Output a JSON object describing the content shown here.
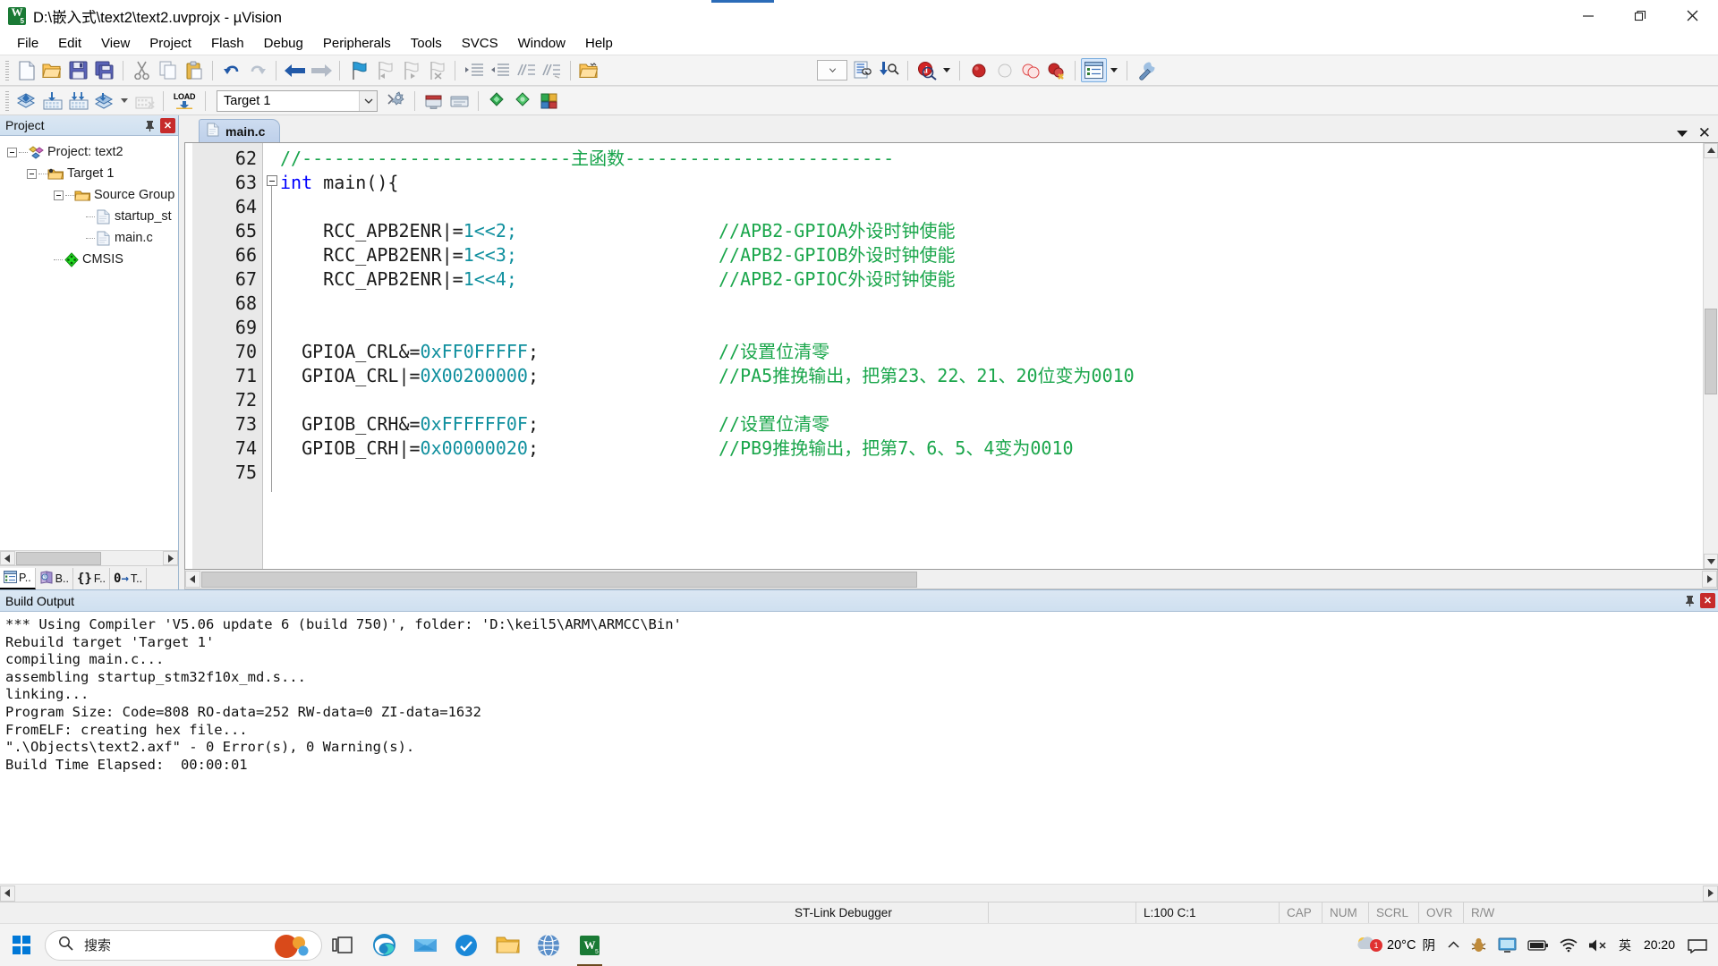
{
  "window": {
    "title": "D:\\嵌入式\\text2\\text2.uvprojx - µVision",
    "app_icon": "keil-uvision-icon",
    "minimize": "—",
    "maximize": "❐",
    "close": "✕"
  },
  "menubar": {
    "items": [
      {
        "label": "File"
      },
      {
        "label": "Edit"
      },
      {
        "label": "View"
      },
      {
        "label": "Project"
      },
      {
        "label": "Flash"
      },
      {
        "label": "Debug"
      },
      {
        "label": "Peripherals"
      },
      {
        "label": "Tools"
      },
      {
        "label": "SVCS"
      },
      {
        "label": "Window"
      },
      {
        "label": "Help"
      }
    ]
  },
  "toolbar_main": {
    "icons": [
      "new-file-icon",
      "open-file-icon",
      "save-icon",
      "save-all-icon",
      "cut-icon",
      "copy-icon",
      "paste-icon",
      "undo-icon",
      "redo-icon",
      "navigate-back-icon",
      "navigate-forward-icon",
      "insert-bookmark-icon",
      "prev-bookmark-icon",
      "next-bookmark-icon",
      "clear-bookmarks-icon",
      "indent-icon",
      "outdent-icon",
      "comment-icon",
      "uncomment-icon",
      "open-folder-browse-icon",
      "dropdown-combo",
      "find-in-files-icon",
      "incremental-find-icon",
      "debug-session-icon",
      "debug-dropdown-caret",
      "insert-breakpoint-icon",
      "disable-breakpoint-icon",
      "kill-all-breakpoints-icon",
      "disable-all-breakpoints-icon",
      "project-window-icon",
      "project-window-caret",
      "configure-target-icon"
    ]
  },
  "toolbar_build": {
    "icons": [
      "translate-icon",
      "build-icon",
      "rebuild-icon",
      "batch-build-icon",
      "batch-build-caret",
      "stop-build-icon",
      "download-load-icon"
    ],
    "load_label": "LOAD",
    "target_value": "Target 1",
    "target_options": [
      "Target 1"
    ],
    "right_icons": [
      "target-options-icon",
      "manage-runtime-env-icon",
      "pack-installer-icon",
      "multi-project-icon",
      "books-icon",
      "windows-icon",
      "manage-components-icon"
    ]
  },
  "project_panel": {
    "title": "Project",
    "pin_icon": "pin-icon",
    "close_icon": "close-icon",
    "tree": [
      {
        "label": "Project: text2",
        "icon": "project-icon",
        "depth": 0,
        "expandable": true
      },
      {
        "label": "Target 1",
        "icon": "target-folder-icon",
        "depth": 1,
        "expandable": true
      },
      {
        "label": "Source Group",
        "icon": "source-group-folder-icon",
        "depth": 2,
        "expandable": true
      },
      {
        "label": "startup_st",
        "icon": "source-file-icon",
        "depth": 3,
        "expandable": false
      },
      {
        "label": "main.c",
        "icon": "source-file-icon",
        "depth": 3,
        "expandable": false
      },
      {
        "label": "CMSIS",
        "icon": "cmsis-diamond-icon",
        "depth": 2,
        "expandable": false
      }
    ],
    "tabs": [
      {
        "label": "P..",
        "icon": "project-tab-icon",
        "active": true
      },
      {
        "label": "B..",
        "icon": "books-tab-icon",
        "active": false
      },
      {
        "label": "F..",
        "icon": "functions-tab-icon",
        "active": false
      },
      {
        "label": "T..",
        "icon": "templates-tab-icon",
        "active": false
      }
    ]
  },
  "editor": {
    "tab_label": "main.c",
    "tab_icon": "c-file-icon",
    "tab_caret_icon": "chevron-down-icon",
    "tab_close_icon": "close-icon",
    "lines": [
      {
        "no": "62",
        "code": "//-------------------------",
        "code2": "主函数",
        "code3": "-------------------------",
        "type": "comment-dash",
        "comment": ""
      },
      {
        "no": "63",
        "code": "int main(){",
        "type": "code-fold",
        "comment": ""
      },
      {
        "no": "64",
        "code": "",
        "type": "blank",
        "comment": ""
      },
      {
        "no": "65",
        "code": "    RCC_APB2ENR|=1<<2;",
        "type": "code",
        "comment": "//APB2-GPIOA外设时钟使能"
      },
      {
        "no": "66",
        "code": "    RCC_APB2ENR|=1<<3;",
        "type": "code",
        "comment": "//APB2-GPIOB外设时钟使能"
      },
      {
        "no": "67",
        "code": "    RCC_APB2ENR|=1<<4;",
        "type": "code",
        "comment": "//APB2-GPIOC外设时钟使能"
      },
      {
        "no": "68",
        "code": "",
        "type": "blank",
        "comment": ""
      },
      {
        "no": "69",
        "code": "",
        "type": "blank",
        "comment": ""
      },
      {
        "no": "70",
        "code": "  GPIOA_CRL&=0xFF0FFFFF;",
        "type": "code",
        "comment": "//设置位清零"
      },
      {
        "no": "71",
        "code": "  GPIOA_CRL|=0X00200000;",
        "type": "code",
        "comment": "//PA5推挽输出，把第23、22、21、20位变为0010"
      },
      {
        "no": "72",
        "code": "",
        "type": "blank",
        "comment": ""
      },
      {
        "no": "73",
        "code": "  GPIOB_CRH&=0xFFFFFF0F;",
        "type": "code",
        "comment": "//设置位清零"
      },
      {
        "no": "74",
        "code": "  GPIOB_CRH|=0x00000020;",
        "type": "code",
        "comment": "//PB9推挽输出，把第7、6、5、4变为0010"
      },
      {
        "no": "75",
        "code": "",
        "type": "blank",
        "comment": ""
      }
    ]
  },
  "build_output": {
    "title": "Build Output",
    "pin_icon": "pin-icon",
    "close_icon": "close-icon",
    "lines": [
      "*** Using Compiler 'V5.06 update 6 (build 750)', folder: 'D:\\keil5\\ARM\\ARMCC\\Bin'",
      "Rebuild target 'Target 1'",
      "compiling main.c...",
      "assembling startup_stm32f10x_md.s...",
      "linking...",
      "Program Size: Code=808 RO-data=252 RW-data=0 ZI-data=1632",
      "FromELF: creating hex file...",
      "\".\\Objects\\text2.axf\" - 0 Error(s), 0 Warning(s).",
      "Build Time Elapsed:  00:00:01"
    ]
  },
  "statusbar": {
    "debugger": "ST-Link Debugger",
    "position": "L:100 C:1",
    "cap": "CAP",
    "num": "NUM",
    "scrl": "SCRL",
    "ovr": "OVR",
    "rw": "R/W"
  },
  "taskbar": {
    "start_icon": "windows-start-icon",
    "search_placeholder": "搜索",
    "search_icon": "search-icon",
    "apps": [
      {
        "name": "task-view-icon",
        "active": false
      },
      {
        "name": "microsoft-edge-icon",
        "active": false
      },
      {
        "name": "wps-office-icon",
        "active": false
      },
      {
        "name": "blue-app-icon",
        "active": false
      },
      {
        "name": "file-explorer-icon",
        "active": false
      },
      {
        "name": "chrome-globe-icon",
        "active": false
      },
      {
        "name": "keil-uvision-taskbar-icon",
        "active": true
      }
    ],
    "weather_temp": "20°C",
    "weather_desc": "阴",
    "weather_badge": "1",
    "tray_icons": [
      "chevron-up-icon",
      "bug-icon",
      "monitor-icon",
      "battery-icon",
      "wifi-icon",
      "volume-icon"
    ],
    "ime": "英",
    "clock_time": "20:20",
    "notification_icon": "notification-icon"
  },
  "colors": {
    "accent": "#2b6cb8",
    "comment_green": "#16a34a",
    "keyword_blue": "#0000ff",
    "number_teal": "#0f8f9e",
    "panel_header": "#cfe0f0",
    "tab_active": "#bed0ea",
    "close_red": "#c62b2b"
  }
}
